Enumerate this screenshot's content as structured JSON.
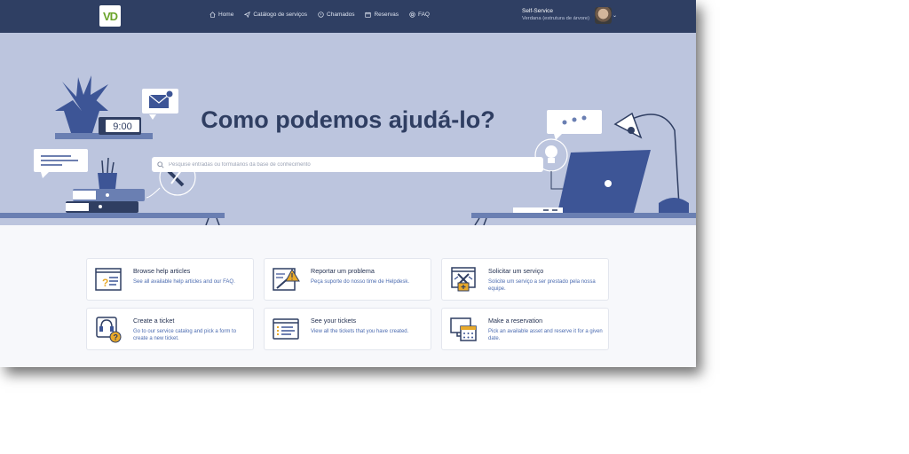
{
  "nav": {
    "items": [
      {
        "label": "Home",
        "icon": "home-icon"
      },
      {
        "label": "Catálogo de serviços",
        "icon": "paper-plane-icon"
      },
      {
        "label": "Chamados",
        "icon": "alert-circle-icon"
      },
      {
        "label": "Reservas",
        "icon": "calendar-icon"
      },
      {
        "label": "FAQ",
        "icon": "lifebuoy-icon"
      }
    ]
  },
  "user": {
    "profile": "Self-Service",
    "entity": "Verdana (estrutura de árvore)"
  },
  "hero": {
    "title": "Como podemos ajudá-lo?",
    "clock": "9:00",
    "search_placeholder": "Pesquise entradas ou formulários da base de conhecimento"
  },
  "tiles": [
    {
      "title": "Browse help articles",
      "desc": "See all available help articles and our FAQ.",
      "icon": "help-articles-icon"
    },
    {
      "title": "Reportar um problema",
      "desc": "Peça suporte do nosso time de Helpdesk.",
      "icon": "report-problem-icon"
    },
    {
      "title": "Solicitar um serviço",
      "desc": "Solicite um serviço a ser prestado pela nossa equipe.",
      "icon": "request-service-icon"
    },
    {
      "title": "Create a ticket",
      "desc": "Go to our service catalog and pick a form to create a new ticket.",
      "icon": "create-ticket-icon"
    },
    {
      "title": "See your tickets",
      "desc": "View all the tickets that you have created.",
      "icon": "tickets-list-icon"
    },
    {
      "title": "Make a reservation",
      "desc": "Pick an available asset and reserve it for a given date.",
      "icon": "reservation-icon"
    }
  ],
  "colors": {
    "topbar": "#2f3f63",
    "hero_bg": "#bcc5de",
    "accent": "#4b6bb0",
    "title": "#2f3e62"
  }
}
